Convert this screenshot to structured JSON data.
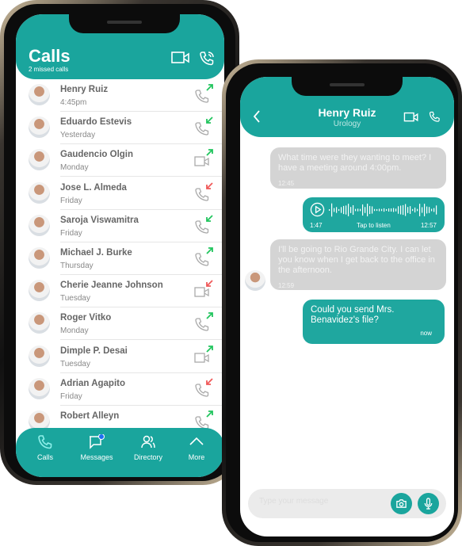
{
  "calls": {
    "title": "Calls",
    "subtitle": "2 missed calls",
    "header_icons": [
      "video-icon",
      "phone-icon"
    ],
    "items": [
      {
        "name": "Henry Ruiz",
        "time": "4:45pm",
        "type": "phone",
        "direction": "outgoing",
        "color": "#22c55e"
      },
      {
        "name": "Eduardo Estevis",
        "time": "Yesterday",
        "type": "phone",
        "direction": "incoming",
        "color": "#22c55e"
      },
      {
        "name": "Gaudencio Olgin",
        "time": "Monday",
        "type": "video",
        "direction": "outgoing",
        "color": "#22c55e"
      },
      {
        "name": "Jose L. Almeda",
        "time": "Friday",
        "type": "phone",
        "direction": "incoming",
        "color": "#f05a5a"
      },
      {
        "name": "Saroja Viswamitra",
        "time": "Friday",
        "type": "phone",
        "direction": "incoming",
        "color": "#22c55e"
      },
      {
        "name": "Michael J. Burke",
        "time": "Thursday",
        "type": "phone",
        "direction": "outgoing",
        "color": "#22c55e"
      },
      {
        "name": "Cherie Jeanne Johnson",
        "time": "Tuesday",
        "type": "video",
        "direction": "incoming",
        "color": "#f05a5a"
      },
      {
        "name": "Roger Vitko",
        "time": "Monday",
        "type": "phone",
        "direction": "outgoing",
        "color": "#22c55e"
      },
      {
        "name": "Dimple P. Desai",
        "time": "Tuesday",
        "type": "video",
        "direction": "outgoing",
        "color": "#22c55e"
      },
      {
        "name": "Adrian Agapito",
        "time": "Friday",
        "type": "phone",
        "direction": "incoming",
        "color": "#f05a5a"
      },
      {
        "name": "Robert Alleyn",
        "time": "",
        "type": "phone",
        "direction": "outgoing",
        "color": "#22c55e"
      }
    ],
    "tabs": [
      {
        "label": "Calls",
        "active": true
      },
      {
        "label": "Messages",
        "badge": true
      },
      {
        "label": "Directory"
      },
      {
        "label": "More"
      }
    ]
  },
  "chat": {
    "name": "Henry Ruiz",
    "subtitle": "Urology",
    "messages": [
      {
        "from": "them",
        "text": "What time were they wanting to meet? I have a meeting around 4:00pm.",
        "time": "12:45"
      },
      {
        "from": "me",
        "type": "voice",
        "duration": "1:47",
        "label": "Tap to listen",
        "time": "12:57"
      },
      {
        "from": "them",
        "text": "I'll be going to Rio Grande City. I can let you know when I get back to the office in the afternoon.",
        "time": "12:59"
      },
      {
        "from": "me",
        "text": "Could you send Mrs. Benavidez's file?",
        "time": "now"
      }
    ],
    "composer": {
      "placeholder": "Type your message",
      "value": ""
    }
  },
  "colors": {
    "accent": "#1aa59d",
    "incoming_bubble": "#d4d4d4",
    "answered": "#22c55e",
    "missed": "#f05a5a",
    "badge": "#1d6ff2"
  }
}
